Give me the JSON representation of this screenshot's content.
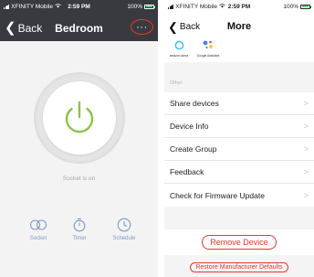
{
  "colors": {
    "accent_red": "#e0392a",
    "power_green": "#8bc34a",
    "tab_blue": "#7e9ac8",
    "dark_header": "#393a40"
  },
  "left": {
    "status": {
      "carrier": "XFINITY Mobile",
      "time": "2:59 PM",
      "battery": "100%"
    },
    "nav": {
      "back": "Back",
      "title": "Bedroom",
      "more": "···"
    },
    "status_text": "Socket is on",
    "tabs": [
      {
        "label": "Socket",
        "icon": "toggle-icon"
      },
      {
        "label": "Timer",
        "icon": "stopwatch-icon"
      },
      {
        "label": "Schedule",
        "icon": "clock-icon"
      }
    ]
  },
  "right": {
    "status": {
      "carrier": "XFINITY Mobile",
      "time": "2:59 PM",
      "battery": "100%"
    },
    "nav": {
      "back": "Back",
      "title": "More"
    },
    "assistants": [
      {
        "label": "amazon alexa",
        "icon": "alexa-icon"
      },
      {
        "label": "Google Assistant",
        "icon": "google-assistant-icon"
      }
    ],
    "section_label": "Other",
    "menu": [
      {
        "label": "Share devices"
      },
      {
        "label": "Device Info"
      },
      {
        "label": "Create Group"
      },
      {
        "label": "Feedback"
      },
      {
        "label": "Check for Firmware Update"
      }
    ],
    "remove_label": "Remove Device",
    "restore_label": "Restore Manufacturer Defaults"
  }
}
